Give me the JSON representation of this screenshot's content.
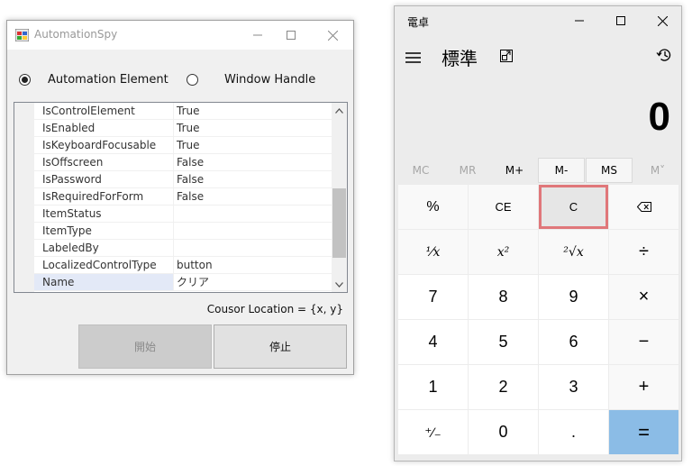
{
  "spy": {
    "title": "AutomationSpy",
    "radio_element_label": "Automation Element",
    "radio_handle_label": "Window Handle",
    "radio_selected": "Automation Element",
    "properties": [
      {
        "name": "IsControlElement",
        "value": "True"
      },
      {
        "name": "IsEnabled",
        "value": "True"
      },
      {
        "name": "IsKeyboardFocusable",
        "value": "True"
      },
      {
        "name": "IsOffscreen",
        "value": "False"
      },
      {
        "name": "IsPassword",
        "value": "False"
      },
      {
        "name": "IsRequiredForForm",
        "value": "False"
      },
      {
        "name": "ItemStatus",
        "value": ""
      },
      {
        "name": "ItemType",
        "value": ""
      },
      {
        "name": "LabeledBy",
        "value": ""
      },
      {
        "name": "LocalizedControlType",
        "value": "button"
      },
      {
        "name": "Name",
        "value": "クリア"
      }
    ],
    "cursor_location": "Cousor Location = {x, y}",
    "start_label": "開始",
    "stop_label": "停止"
  },
  "calc": {
    "title": "電卓",
    "mode": "標準",
    "display": "0",
    "memory": [
      "MC",
      "MR",
      "M+",
      "M-",
      "MS",
      "M˅"
    ],
    "keys": {
      "percent": "%",
      "ce": "CE",
      "c": "C",
      "backspace": "⌫",
      "reciprocal": "⅟x",
      "square": "x²",
      "sqrt": "²√x",
      "divide": "÷",
      "n7": "7",
      "n8": "8",
      "n9": "9",
      "multiply": "×",
      "n4": "4",
      "n5": "5",
      "n6": "6",
      "minus": "−",
      "n1": "1",
      "n2": "2",
      "n3": "3",
      "plus": "+",
      "negate": "⁺∕₋",
      "n0": "0",
      "decimal": ".",
      "equals": "="
    },
    "colors": {
      "highlight": "#e0777a",
      "equals": "#8bbce6"
    }
  }
}
